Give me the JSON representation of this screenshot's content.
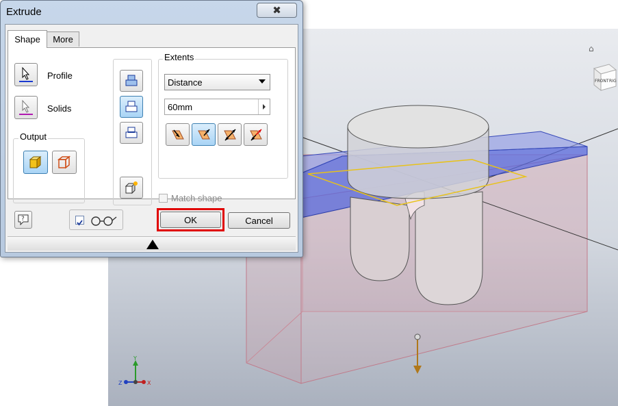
{
  "dialog": {
    "title": "Extrude",
    "close_glyph": "✖",
    "tabs": [
      {
        "label": "Shape",
        "active": true
      },
      {
        "label": "More",
        "active": false
      }
    ],
    "profile_label": "Profile",
    "solids_label": "Solids",
    "output_group_title": "Output",
    "extents": {
      "group_title": "Extents",
      "selected": "Distance",
      "distance_value": "60mm"
    },
    "match_shape_label": "Match shape",
    "match_shape_checked": false,
    "preview_checked": true,
    "ok_label": "OK",
    "cancel_label": "Cancel"
  },
  "icons": {
    "profile": "cursor-arrow-icon",
    "solids": "cursor-arrow-icon",
    "output_solid": "solid-cube-icon",
    "output_surface": "surface-cube-icon",
    "operations": [
      "join-icon",
      "cut-icon",
      "intersect-icon",
      "new-solid-icon"
    ],
    "directions": [
      "direction-1-icon",
      "direction-2-icon",
      "symmetric-icon",
      "asymmetric-icon"
    ],
    "help": "help-icon",
    "preview": "glasses-icon",
    "viewcube": "viewcube-icon",
    "home": "home-icon",
    "triad": "axis-triad-icon"
  },
  "viewport": {
    "viewcube_labels": [
      "FRONT",
      "RIG"
    ],
    "triad_labels": [
      "Y",
      "Z",
      "X"
    ]
  },
  "colors": {
    "highlight": "#e00000",
    "selected_button": "#a9d4f5",
    "profile_plane": "#4f5fd0",
    "block_edges": "#c07a8a"
  }
}
